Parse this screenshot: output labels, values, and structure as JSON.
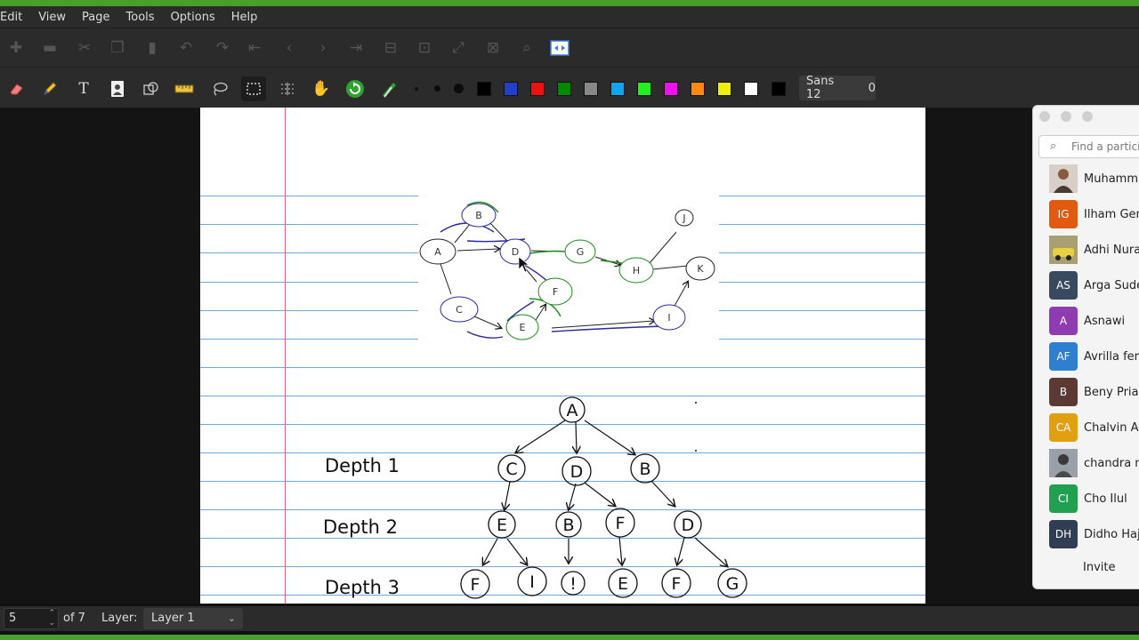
{
  "menu": [
    "Edit",
    "View",
    "Page",
    "Tools",
    "Options",
    "Help"
  ],
  "toolbar1": {
    "icons": [
      "new-page-icon",
      "open-icon",
      "cut-icon",
      "copy-icon",
      "paste-icon",
      "undo-icon",
      "redo-icon",
      "first-page-icon",
      "prev-page-icon",
      "next-page-icon",
      "last-page-icon",
      "zoom-out-icon",
      "zoom-fit-icon",
      "zoom-in-icon",
      "zoom-100-icon",
      "search-icon",
      "fullscreen-icon"
    ]
  },
  "toolbar2": {
    "tools": [
      "eraser",
      "pen",
      "text",
      "image",
      "shapes",
      "ruler",
      "lasso",
      "rect-select",
      "vertical-space",
      "hand",
      "refresh",
      "highlighter"
    ],
    "colors": [
      "#000000",
      "#2540c8",
      "#ee1111",
      "#008a00",
      "#888888",
      "#12a4ee",
      "#22ee22",
      "#ee11ee",
      "#ff8811",
      "#eeee11",
      "#ffffff",
      "#000000"
    ],
    "font_name": "Sans 12",
    "font_extra": "0"
  },
  "canvas": {
    "depth_labels": [
      "Depth 1",
      "Depth 2",
      "Depth 3"
    ],
    "graph_nodes": [
      "A",
      "B",
      "D",
      "G",
      "H",
      "J",
      "K",
      "C",
      "E",
      "F",
      "I"
    ],
    "tree": {
      "root": "A",
      "level1": [
        "C",
        "D",
        "B"
      ],
      "level2": [
        "E",
        "B",
        "F",
        "D"
      ],
      "level3": [
        "F",
        "I",
        "!",
        "E",
        "F",
        "G"
      ]
    }
  },
  "status": {
    "page_number": "5",
    "page_total": "of 7",
    "layer_label": "Layer:",
    "layer_value": "Layer 1"
  },
  "participants": {
    "search_placeholder": "Find a participant",
    "items": [
      {
        "initials": "",
        "name": "Muhammad",
        "color": "#6b4f3a"
      },
      {
        "initials": "IG",
        "name": "Ilham Gemi",
        "color": "#e05a10"
      },
      {
        "initials": "",
        "name": "Adhi Nuraha",
        "color": "#8a8040"
      },
      {
        "initials": "AS",
        "name": "Arga Sudew",
        "color": "#3a4a5e"
      },
      {
        "initials": "A",
        "name": "Asnawi",
        "color": "#8e3cb0"
      },
      {
        "initials": "AF",
        "name": "Avrilla ferri",
        "color": "#2f7fd0"
      },
      {
        "initials": "B",
        "name": "Beny Priamb",
        "color": "#5a3a32"
      },
      {
        "initials": "CA",
        "name": "Chalvin Alde",
        "color": "#e0a010"
      },
      {
        "initials": "",
        "name": "chandra mo",
        "color": "#707070"
      },
      {
        "initials": "CI",
        "name": "Cho Ilul",
        "color": "#20a050"
      },
      {
        "initials": "DH",
        "name": "Didho Hajur",
        "color": "#2f3e52"
      }
    ],
    "invite_label": "Invite"
  }
}
